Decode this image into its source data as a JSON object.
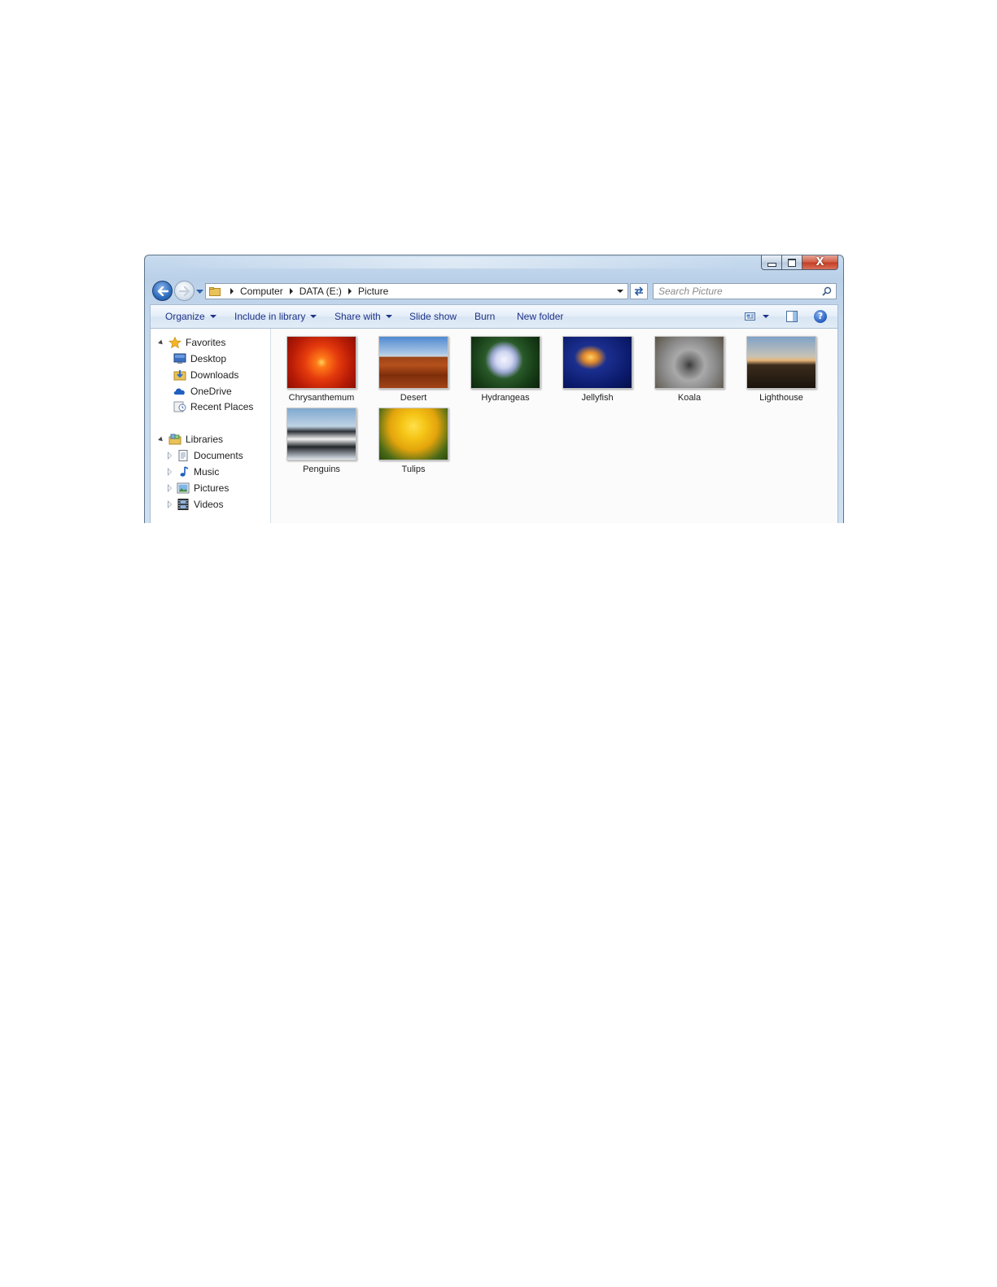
{
  "window": {
    "caption": {
      "minimize": "—",
      "maximize": "□",
      "close": "X"
    }
  },
  "address": {
    "crumbs": [
      "Computer",
      "DATA (E:)",
      "Picture"
    ],
    "search_placeholder": "Search Picture"
  },
  "toolbar": {
    "organize": "Organize",
    "include_in_library": "Include in library",
    "share_with": "Share with",
    "slide_show": "Slide show",
    "burn": "Burn",
    "new_folder": "New folder"
  },
  "nav_pane": {
    "favorites": {
      "label": "Favorites",
      "items": [
        "Desktop",
        "Downloads",
        "OneDrive",
        "Recent Places"
      ]
    },
    "libraries": {
      "label": "Libraries",
      "items": [
        "Documents",
        "Music",
        "Pictures",
        "Videos"
      ]
    }
  },
  "files": [
    {
      "name": "Chrysanthemum",
      "icon": "chrysanthemum-thumbnail",
      "color": "#e43a0d"
    },
    {
      "name": "Desert",
      "icon": "desert-thumbnail",
      "color": "#b5501c"
    },
    {
      "name": "Hydrangeas",
      "icon": "hydrangeas-thumbnail",
      "color": "#cfd6f0"
    },
    {
      "name": "Jellyfish",
      "icon": "jellyfish-thumbnail",
      "color": "#0b1a6b"
    },
    {
      "name": "Koala",
      "icon": "koala-thumbnail",
      "color": "#8a8a8a"
    },
    {
      "name": "Lighthouse",
      "icon": "lighthouse-thumbnail",
      "color": "#3b2c1d"
    },
    {
      "name": "Penguins",
      "icon": "penguins-thumbnail",
      "color": "#2d3238"
    },
    {
      "name": "Tulips",
      "icon": "tulips-thumbnail",
      "color": "#f5c517"
    }
  ]
}
